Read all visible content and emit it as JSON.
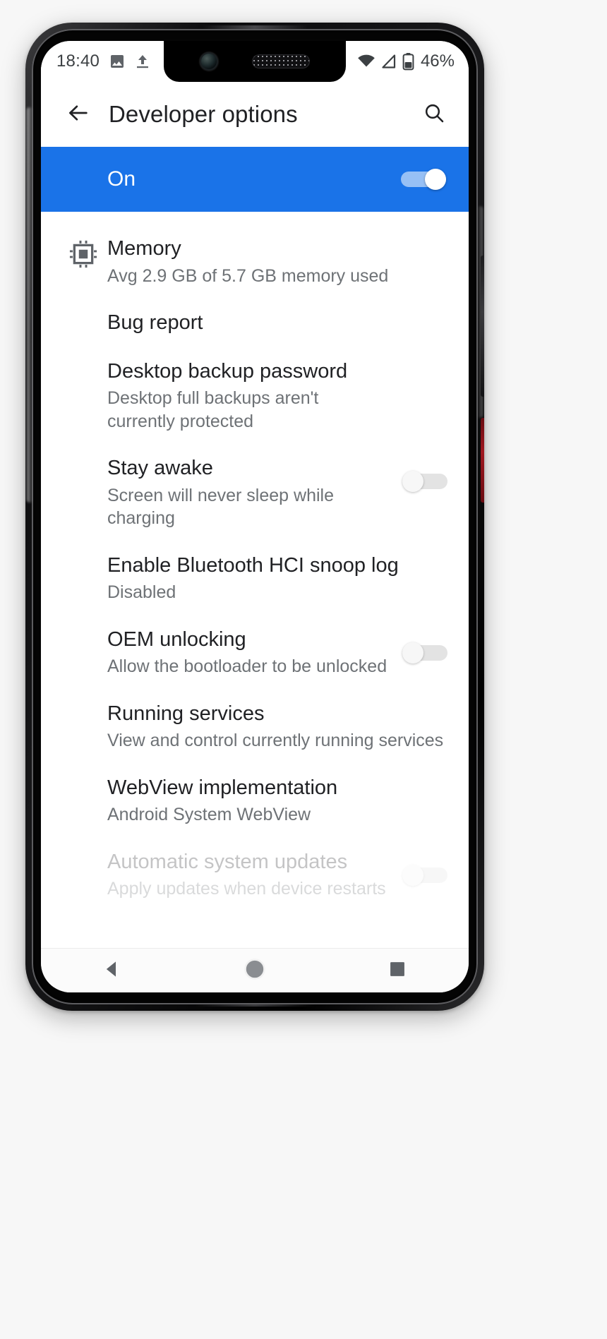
{
  "status_bar": {
    "time": "18:40",
    "left_icons": [
      "image-icon",
      "upload-icon"
    ],
    "right_icons": [
      "wifi-icon",
      "signal-icon",
      "battery-icon"
    ],
    "battery_percent": "46%"
  },
  "app_bar": {
    "back_icon": "arrow-back-icon",
    "title": "Developer options",
    "search_icon": "search-icon"
  },
  "master_switch": {
    "label": "On",
    "state": "on"
  },
  "colors": {
    "accent": "#1a73e8",
    "title_text": "#202124",
    "summary_text": "#6e7276",
    "background": "#ffffff"
  },
  "settings": [
    {
      "name": "memory",
      "icon": "memory-chip-icon",
      "title": "Memory",
      "summary": "Avg 2.9 GB of 5.7 GB memory used",
      "control": "none"
    },
    {
      "name": "bug-report",
      "icon": "",
      "title": "Bug report",
      "summary": "",
      "control": "none"
    },
    {
      "name": "desktop-backup-password",
      "icon": "",
      "title": "Desktop backup password",
      "summary": "Desktop full backups aren't currently protected",
      "control": "none"
    },
    {
      "name": "stay-awake",
      "icon": "",
      "title": "Stay awake",
      "summary": "Screen will never sleep while charging",
      "control": "switch",
      "switch_state": "off"
    },
    {
      "name": "bluetooth-hci-snoop-log",
      "icon": "",
      "title": "Enable Bluetooth HCI snoop log",
      "summary": "Disabled",
      "control": "none"
    },
    {
      "name": "oem-unlocking",
      "icon": "",
      "title": "OEM unlocking",
      "summary": "Allow the bootloader to be unlocked",
      "control": "switch",
      "switch_state": "off"
    },
    {
      "name": "running-services",
      "icon": "",
      "title": "Running services",
      "summary": "View and control currently running services",
      "control": "none"
    },
    {
      "name": "webview-implementation",
      "icon": "",
      "title": "WebView implementation",
      "summary": "Android System WebView",
      "control": "none"
    },
    {
      "name": "automatic-system-updates",
      "icon": "",
      "title": "Automatic system updates",
      "summary": "Apply updates when device restarts",
      "control": "switch",
      "switch_state": "off"
    }
  ],
  "nav_bar": {
    "back_icon": "nav-back-triangle-icon",
    "home_icon": "nav-home-circle-icon",
    "recents_icon": "nav-recents-square-icon"
  }
}
